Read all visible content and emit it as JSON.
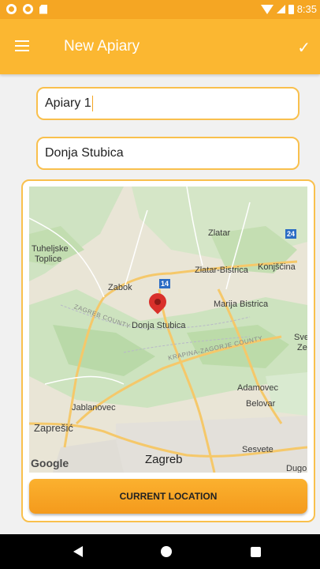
{
  "status_bar": {
    "time": "8:35",
    "icons": [
      "notification-circle-icon",
      "notification-circle-icon",
      "sd-card-icon",
      "wifi-icon",
      "signal-icon",
      "battery-icon"
    ]
  },
  "app_bar": {
    "title": "New Apiary",
    "menu_icon": "hamburger-menu-icon",
    "confirm_icon": "check-icon",
    "background_color": "#fbb731"
  },
  "form": {
    "name_value": "Apiary 1",
    "location_value": "Donja Stubica",
    "field_border_color": "#f9c04d"
  },
  "map": {
    "pin_icon": "map-pin-icon",
    "attribution": "Google",
    "highway_number": "14",
    "route_number": "24",
    "places": {
      "zlatar": "Zlatar",
      "tuheljske": "Tuheljske",
      "toplice": "Toplice",
      "zlatar_bistrica": "Zlatar-Bistrica",
      "konjscina": "Konjščina",
      "zabok": "Zabok",
      "marija_bistrica": "Marija Bistrica",
      "donja_stubica": "Donja Stubica",
      "sve": "Sve",
      "ze": "Ze",
      "adamovec": "Adamovec",
      "jablanovec": "Jablanovec",
      "belovar": "Belovar",
      "zapresic": "Zaprešić",
      "sesvete": "Sesvete",
      "zagreb": "Zagreb",
      "dug": "Dugo"
    },
    "counties": {
      "zagreb_county": "ZAGREB COUNTY",
      "krapina_county": "KRAPINA-ZAGORJE COUNTY"
    }
  },
  "actions": {
    "current_location_label": "CURRENT LOCATION",
    "button_color": "#f5a623"
  },
  "nav_bar": {
    "back_icon": "back-triangle-icon",
    "home_icon": "home-circle-icon",
    "recents_icon": "recents-square-icon"
  }
}
